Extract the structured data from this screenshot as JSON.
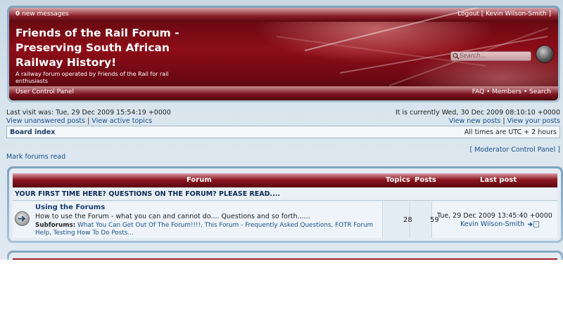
{
  "header": {
    "new_messages_count": "0",
    "new_messages_label": "new messages",
    "logout_label": "Logout [ Kevin Wilson-Smith ]",
    "site_title": "Friends of the Rail Forum - Preserving South African Railway History!",
    "site_description": "A railway forum operated by Friends of the Rail for rail enthusiasts",
    "search_placeholder": "Search...",
    "ucp_label": "User Control Panel",
    "nav_links": [
      "FAQ",
      "Members",
      "Search"
    ],
    "nav_separator": "•",
    "accent_color": "#8e0d18"
  },
  "info": {
    "last_visit": "Last visit was: Tue, 29 Dec 2009 15:54:19 +0000",
    "current_time": "It is currently Wed, 30 Dec 2009 08:10:10 +0000",
    "view_unanswered": "View unanswered posts",
    "view_active": "View active topics",
    "view_new": "View new posts",
    "view_yours": "View your posts",
    "link_separator": "|"
  },
  "navbar": {
    "board_index": "Board index",
    "timezone": "All times are UTC + 2 hours"
  },
  "actions": {
    "mark_read": "Mark forums read",
    "mcp": "[ Moderator Control Panel ]"
  },
  "forum_table": {
    "columns": {
      "forum": "Forum",
      "topics": "Topics",
      "posts": "Posts",
      "last_post": "Last post"
    },
    "category": "YOUR FIRST TIME HERE? QUESTIONS ON THE FORUM? PLEASE READ....",
    "rows": [
      {
        "name": "Using the Forums",
        "description": "How to use the Forum - what you can and cannot do.... Questions and so forth......",
        "subforums_label": "Subforums:",
        "subforums": "What You Can Get Out Of The Forum!!!!, This Forum - Frequently Asked Questions, FOTR Forum Help, Testing How To Do Posts...",
        "topics": "28",
        "posts": "59",
        "last_post_date": "Tue, 29 Dec 2009 13:45:40 +0000",
        "last_post_user": "Kevin Wilson-Smith"
      }
    ]
  }
}
